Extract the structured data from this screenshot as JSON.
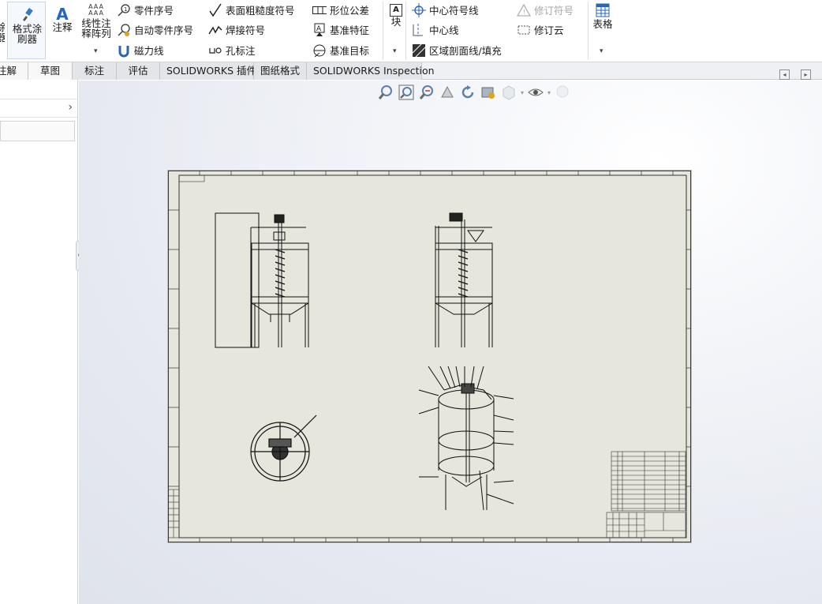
{
  "ribbon": {
    "format_painter": "格式涂\n刷器",
    "note": "注释",
    "linear_pattern": "线性注\n释阵列",
    "balloon": "零件序号",
    "auto_balloon": "自动零件序号",
    "magnetic_line": "磁力线",
    "surface_finish": "表面粗糙度符号",
    "weld_symbol": "焊接符号",
    "hole_callout": "孔标注",
    "gtol": "形位公差",
    "datum_feature": "基准特征",
    "datum_target": "基准目标",
    "block": "块",
    "centermark": "中心符号线",
    "centerline": "中心线",
    "area_hatch": "区域剖面线/填充",
    "revision_symbol": "修订符号",
    "revision_cloud": "修订云",
    "tables": "表格",
    "left_cut_top": "涂",
    "left_cut_bottom": "器"
  },
  "tabs": {
    "annotation": "注解",
    "sketch": "草图",
    "dimension": "标注",
    "evaluate": "评估",
    "addins": "SOLIDWORKS 插件",
    "sheet_format": "图纸格式",
    "inspection": "SOLIDWORKS Inspection"
  },
  "icons": {
    "zoom_fit": "zoom-to-fit-icon",
    "zoom_area": "zoom-to-area-icon",
    "previous_view": "previous-view-icon",
    "rotate": "rotate-icon",
    "pan": "pan-icon",
    "display_style": "display-style-icon",
    "hide_show": "hide-show-items-icon",
    "appearance": "appearance-icon"
  }
}
